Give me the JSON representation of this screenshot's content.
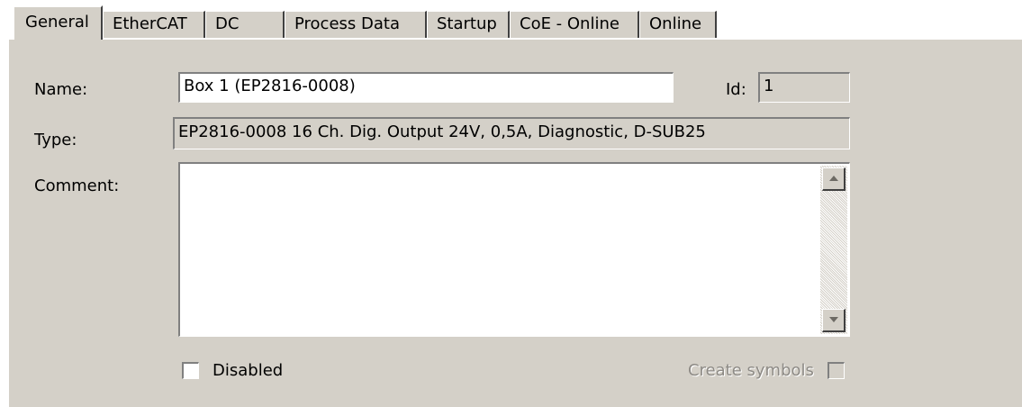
{
  "tabs": [
    {
      "label": "General"
    },
    {
      "label": "EtherCAT"
    },
    {
      "label": "DC"
    },
    {
      "label": "Process Data"
    },
    {
      "label": "Startup"
    },
    {
      "label": "CoE - Online"
    },
    {
      "label": "Online"
    }
  ],
  "form": {
    "name_label": "Name:",
    "name_value": "Box 1 (EP2816-0008)",
    "id_label": "Id:",
    "id_value": "1",
    "type_label": "Type:",
    "type_value": "EP2816-0008 16 Ch. Dig. Output 24V, 0,5A, Diagnostic, D-SUB25",
    "comment_label": "Comment:",
    "comment_value": "",
    "disabled_label": "Disabled",
    "disabled_checked": false,
    "create_symbols_label": "Create symbols",
    "create_symbols_checked": false
  },
  "colors": {
    "panel_bg": "#d4d0c8",
    "field_bg": "#ffffff",
    "disabled_text": "#8d8a85"
  },
  "icons": [
    "scroll-up-arrow-icon",
    "scroll-down-arrow-icon"
  ]
}
